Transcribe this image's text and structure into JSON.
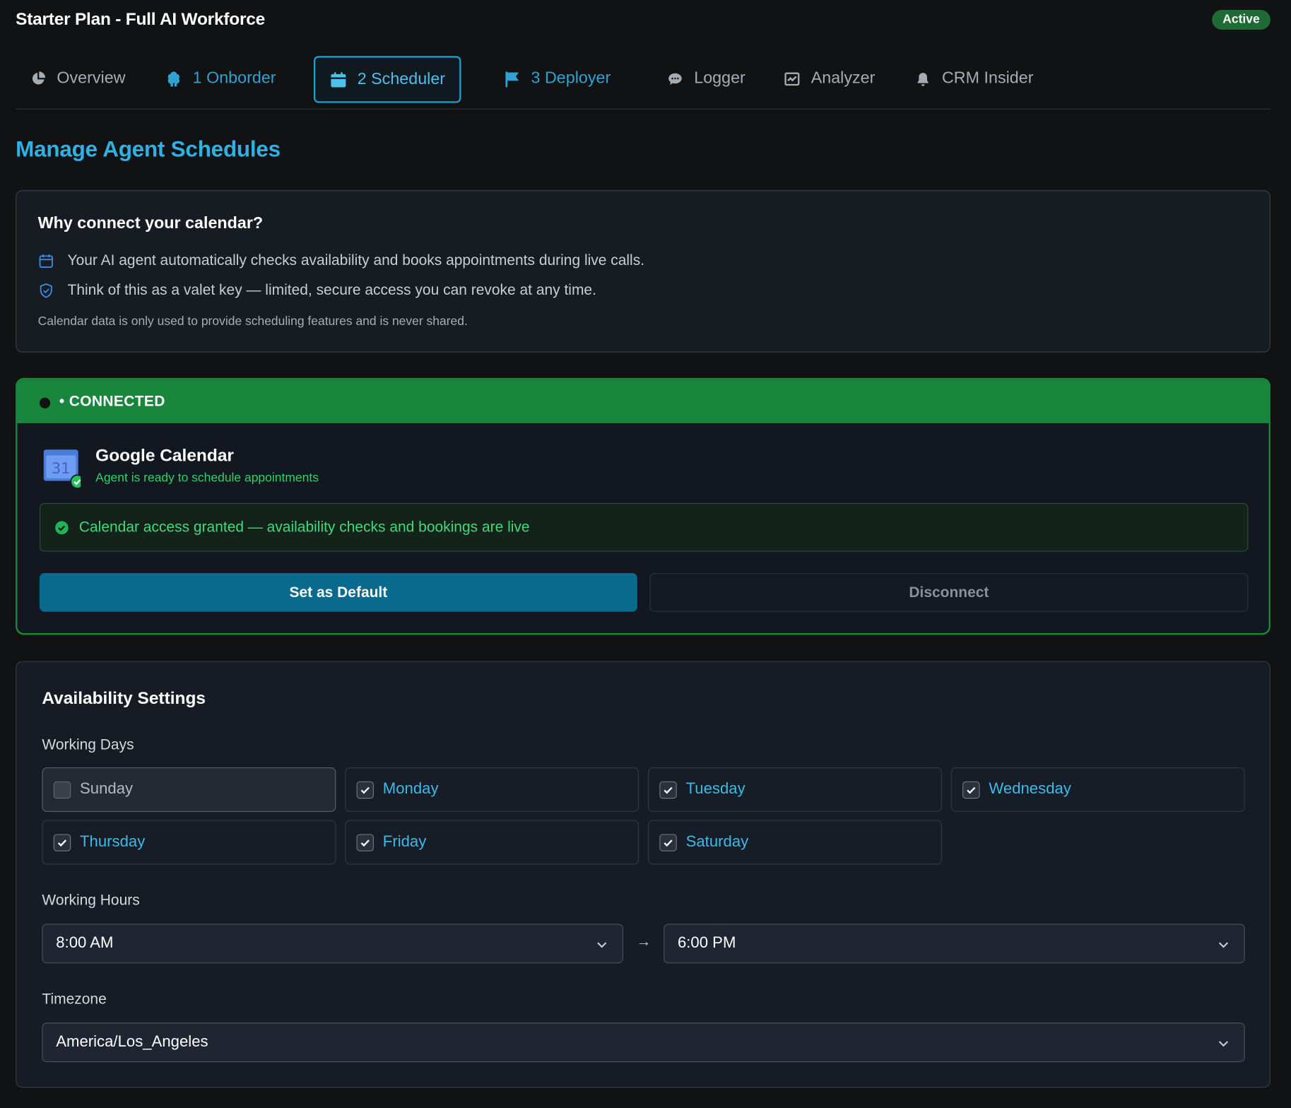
{
  "header": {
    "plan_title": "Starter Plan - Full AI Workforce",
    "status_badge": "Active"
  },
  "tabs": [
    {
      "label": "Overview",
      "icon": "pie-chart-icon",
      "state": "normal"
    },
    {
      "label": "1 Onborder",
      "icon": "brain-icon",
      "state": "step"
    },
    {
      "label": "2 Scheduler",
      "icon": "calendar-icon",
      "state": "current"
    },
    {
      "label": "3 Deployer",
      "icon": "flag-icon",
      "state": "step"
    },
    {
      "label": "Logger",
      "icon": "chat-bubble-icon",
      "state": "normal"
    },
    {
      "label": "Analyzer",
      "icon": "chart-check-icon",
      "state": "normal"
    },
    {
      "label": "CRM Insider",
      "icon": "bell-icon",
      "state": "normal"
    }
  ],
  "page_title": "Manage Agent Schedules",
  "why_card": {
    "title": "Why connect your calendar?",
    "points": [
      {
        "icon": "calendar-icon",
        "text": "Your AI agent automatically checks availability and books appointments during live calls."
      },
      {
        "icon": "shield-check-icon",
        "text": "Think of this as a valet key — limited, secure access you can revoke at any time."
      }
    ],
    "note": "Calendar data is only used to provide scheduling features and is never shared."
  },
  "connection": {
    "status_label": "• CONNECTED",
    "provider_name": "Google Calendar",
    "provider_status": "Agent is ready to schedule appointments",
    "logo_day": "31",
    "access_message": "Calendar access granted — availability checks and bookings are live",
    "set_default_label": "Set as Default",
    "disconnect_label": "Disconnect"
  },
  "availability": {
    "title": "Availability Settings",
    "working_days_label": "Working Days",
    "days": [
      {
        "label": "Sunday",
        "checked": false
      },
      {
        "label": "Monday",
        "checked": true
      },
      {
        "label": "Tuesday",
        "checked": true
      },
      {
        "label": "Wednesday",
        "checked": true
      },
      {
        "label": "Thursday",
        "checked": true
      },
      {
        "label": "Friday",
        "checked": true
      },
      {
        "label": "Saturday",
        "checked": true
      }
    ],
    "working_hours_label": "Working Hours",
    "start_time": "8:00 AM",
    "hours_separator": "→",
    "end_time": "6:00 PM",
    "timezone_label": "Timezone",
    "timezone": "America/Los_Angeles"
  },
  "colors": {
    "accent": "#2fb2e3",
    "connected_green": "#1a853d",
    "primary_button": "#0a6a8d",
    "active_badge": "#1f6a35"
  }
}
